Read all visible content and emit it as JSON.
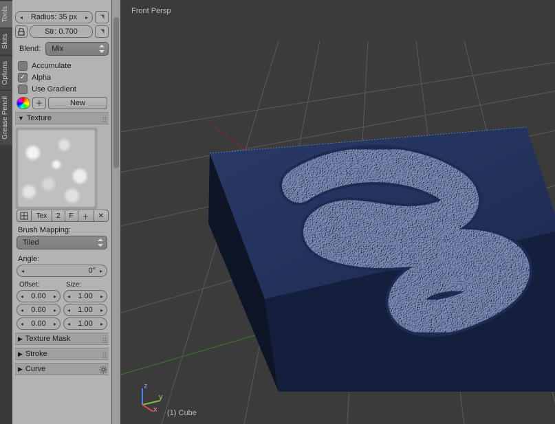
{
  "vertical_tabs": {
    "tools": "Tools",
    "slots": "Slots",
    "options": "Options",
    "grease": "Grease Pencil"
  },
  "brush": {
    "radius_label": "Radius:",
    "radius_value": "35 px",
    "strength_label": "Str:",
    "strength_value": "0.700",
    "blend_label": "Blend:",
    "blend_value": "Mix",
    "accumulate": "Accumulate",
    "alpha": "Alpha",
    "use_gradient": "Use Gradient",
    "new_label": "New"
  },
  "texture": {
    "panel_title": "Texture",
    "strip": {
      "tex": "Tex",
      "two": "2",
      "f": "F"
    },
    "mapping_label": "Brush Mapping:",
    "mapping_value": "Tiled",
    "angle_label": "Angle:",
    "angle_value": "0°",
    "offset_label": "Offset:",
    "size_label": "Size:",
    "offset": [
      "0.00",
      "0.00",
      "0.00"
    ],
    "size": [
      "1.00",
      "1.00",
      "1.00"
    ]
  },
  "panels": {
    "texture_mask": "Texture Mask",
    "stroke": "Stroke",
    "curve": "Curve"
  },
  "viewport": {
    "label": "Front Persp",
    "object": "(1) Cube"
  }
}
